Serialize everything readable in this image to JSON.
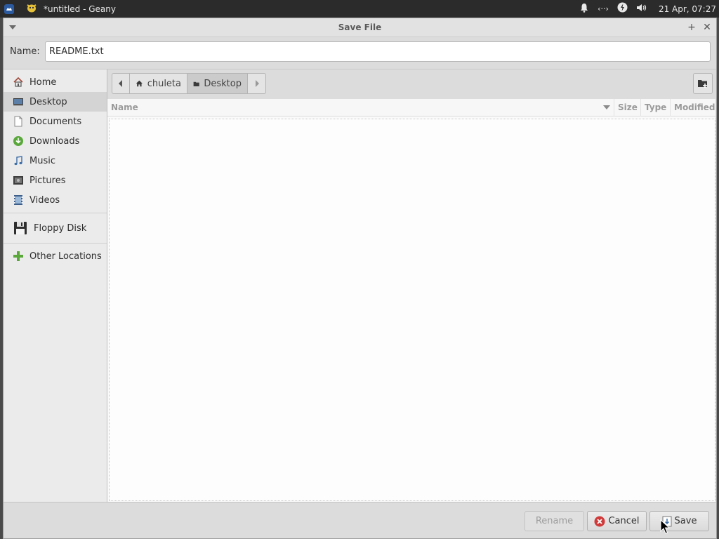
{
  "panel": {
    "task_title": "*untitled - Geany",
    "clock": "21 Apr, 07:27",
    "network_indicator": "‹··›",
    "icons": [
      "xfce-menu-icon",
      "geany-icon",
      "bell-icon",
      "network-icon",
      "power-icon",
      "volume-icon"
    ]
  },
  "dialog": {
    "title": "Save File",
    "name_label": "Name:",
    "name_value": "README.txt"
  },
  "sidebar": {
    "items": [
      {
        "label": "Home",
        "icon": "home-icon"
      },
      {
        "label": "Desktop",
        "icon": "desktop-icon",
        "selected": true
      },
      {
        "label": "Documents",
        "icon": "document-icon"
      },
      {
        "label": "Downloads",
        "icon": "download-icon"
      },
      {
        "label": "Music",
        "icon": "music-icon"
      },
      {
        "label": "Pictures",
        "icon": "picture-icon"
      },
      {
        "label": "Videos",
        "icon": "video-icon"
      }
    ],
    "devices": [
      {
        "label": "Floppy Disk",
        "icon": "floppy-icon"
      }
    ],
    "other": [
      {
        "label": "Other Locations",
        "icon": "plus-icon"
      }
    ]
  },
  "pathbar": {
    "segments": [
      {
        "label": "chuleta",
        "icon": "home-icon"
      },
      {
        "label": "Desktop",
        "icon": "folder-icon",
        "active": true
      }
    ]
  },
  "columns": {
    "name": "Name",
    "size": "Size",
    "type": "Type",
    "modified": "Modified"
  },
  "files": [],
  "buttons": {
    "rename": "Rename",
    "cancel": "Cancel",
    "save": "Save"
  },
  "colors": {
    "panel_bg": "#2b2b2b",
    "dialog_bg": "#dcdcdc",
    "cancel_icon": "#d03a3a",
    "downloads_icon": "#5aa83c",
    "other_locations_icon": "#5aa83c"
  }
}
